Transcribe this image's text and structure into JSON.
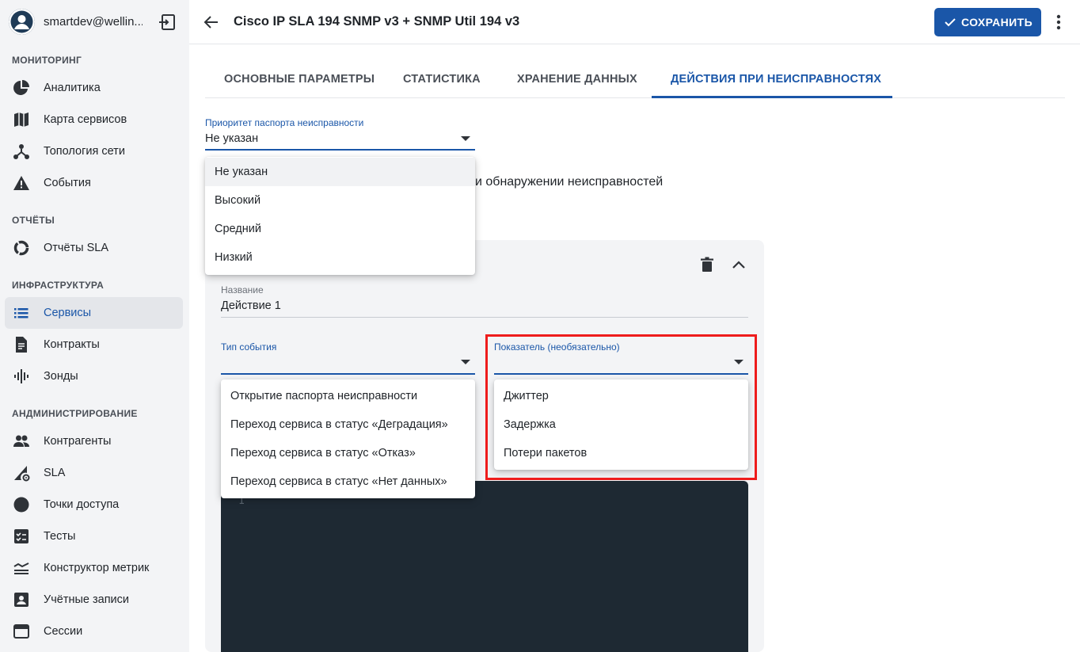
{
  "user": {
    "name": "smartdev@wellin..."
  },
  "sidebar": {
    "sections": [
      {
        "title": "МОНИТОРИНГ"
      },
      {
        "title": "ОТЧЁТЫ"
      },
      {
        "title": "ИНФРАСТРУКТУРА"
      },
      {
        "title": "АНДМИНИСТРИРОВАНИЕ"
      }
    ],
    "items": [
      {
        "label": "Аналитика",
        "icon": "pie-chart-icon"
      },
      {
        "label": "Карта сервисов",
        "icon": "map-icon"
      },
      {
        "label": "Топология сети",
        "icon": "topology-icon"
      },
      {
        "label": "События",
        "icon": "warning-icon"
      },
      {
        "label": "Отчёты SLA",
        "icon": "donut-icon"
      },
      {
        "label": "Сервисы",
        "icon": "list-icon",
        "active": true
      },
      {
        "label": "Контракты",
        "icon": "document-icon"
      },
      {
        "label": "Зонды",
        "icon": "waveform-icon"
      },
      {
        "label": "Контрагенты",
        "icon": "people-icon"
      },
      {
        "label": "SLA",
        "icon": "sla-settings-icon"
      },
      {
        "label": "Точки доступа",
        "icon": "circle-icon"
      },
      {
        "label": "Тесты",
        "icon": "checklist-icon"
      },
      {
        "label": "Конструктор метрик",
        "icon": "metrics-icon"
      },
      {
        "label": "Учётные записи",
        "icon": "account-box-icon"
      },
      {
        "label": "Сессии",
        "icon": "browser-window-icon"
      }
    ]
  },
  "header": {
    "title": "Cisco IP SLA 194 SNMP v3 + SNMP Util 194 v3",
    "save_label": "СОХРАНИТЬ"
  },
  "tabs": [
    {
      "label": "ОСНОВНЫЕ ПАРАМЕТРЫ"
    },
    {
      "label": "СТАТИСТИКА"
    },
    {
      "label": "ХРАНЕНИЕ ДАННЫХ"
    },
    {
      "label": "ДЕЙСТВИЯ ПРИ НЕИСПРАВНОСТЯХ",
      "active": true
    }
  ],
  "priority": {
    "label": "Приоритет паспорта неисправности",
    "value": "Не указан",
    "options": [
      "Не указан",
      "Высокий",
      "Средний",
      "Низкий"
    ]
  },
  "background_text": "и обнаружении неисправностей",
  "action": {
    "name_label": "Название",
    "name_value": "Действие 1",
    "event_type_label": "Тип события",
    "event_type_options": [
      "Открытие паспорта неисправности",
      "Переход сервиса в статус «Деградация»",
      "Переход сервиса в статус «Отказ»",
      "Переход сервиса в статус «Нет данных»"
    ],
    "metric_label": "Показатель (необязательно)",
    "metric_options": [
      "Джиттер",
      "Задержка",
      "Потери пакетов"
    ],
    "code_line_number": "1"
  },
  "colors": {
    "accent": "#1a56a8",
    "highlight": "#ee1c1c",
    "sidebar_bg": "#f3f4f6",
    "code_bg": "#1e2933"
  }
}
